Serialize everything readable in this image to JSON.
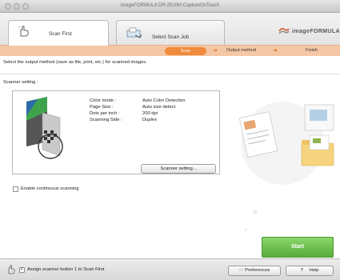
{
  "window": {
    "title": "imageFORMULA DR-2510M CaptureOnTouch"
  },
  "tabs": [
    {
      "label": "Scan First",
      "active": true,
      "icon": "hand-pointer-icon"
    },
    {
      "label": "Select Scan Job",
      "active": false,
      "icon": "scanner-document-icon"
    }
  ],
  "brand": {
    "text": "imageFORMULA"
  },
  "steps": [
    {
      "label": "Scan",
      "active": true
    },
    {
      "label": "Output method",
      "active": false
    },
    {
      "label": "Finish",
      "active": false
    }
  ],
  "main": {
    "instruction": "Select the output method (save as file, print, etc.) for scanned images.",
    "section_label": "Scanner setting :",
    "settings": [
      {
        "key": "Color mode :",
        "value": "Auto Color Detection"
      },
      {
        "key": "Page Size :",
        "value": "Auto size detect"
      },
      {
        "key": "Dots per inch :",
        "value": "200 dpi"
      },
      {
        "key": "Scanning Side :",
        "value": "Duplex"
      }
    ],
    "scanner_setting_button": "Scanner setting...",
    "continuous_scanning_label": "Enable continuous scanning",
    "continuous_scanning_checked": false,
    "start_button": "Start"
  },
  "footer": {
    "assign_label": "Assign scanner button 1 to Scan First",
    "assign_checked": true,
    "preferences_label": "Preferences",
    "help_label": "Help"
  },
  "colors": {
    "accent_orange": "#f08a3c",
    "progress_bg": "#f5c7a4",
    "start_green": "#57ad3a"
  }
}
